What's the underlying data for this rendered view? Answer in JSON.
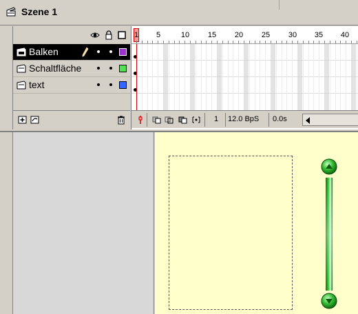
{
  "scene": {
    "title": "Szene 1",
    "icon": "scene-icon"
  },
  "timeline": {
    "header_icons": [
      "eye-icon",
      "lock-icon",
      "outline-icon"
    ],
    "ruler_numbers": [
      "1",
      "5",
      "10",
      "15",
      "20",
      "25",
      "30",
      "35",
      "40"
    ],
    "layers": [
      {
        "name": "Balken",
        "selected": true,
        "pencil": true,
        "color": "#9933cc"
      },
      {
        "name": "Schaltfläche",
        "selected": false,
        "pencil": false,
        "color": "#55dd55"
      },
      {
        "name": "text",
        "selected": false,
        "pencil": false,
        "color": "#3366ff"
      }
    ],
    "footer": {
      "current_frame": "1",
      "frame_rate": "12.0 BpS",
      "elapsed": "0.0s"
    }
  },
  "stage": {
    "canvas_color": "#ffffcc",
    "scroll_arrow_color": "#33cc33"
  }
}
